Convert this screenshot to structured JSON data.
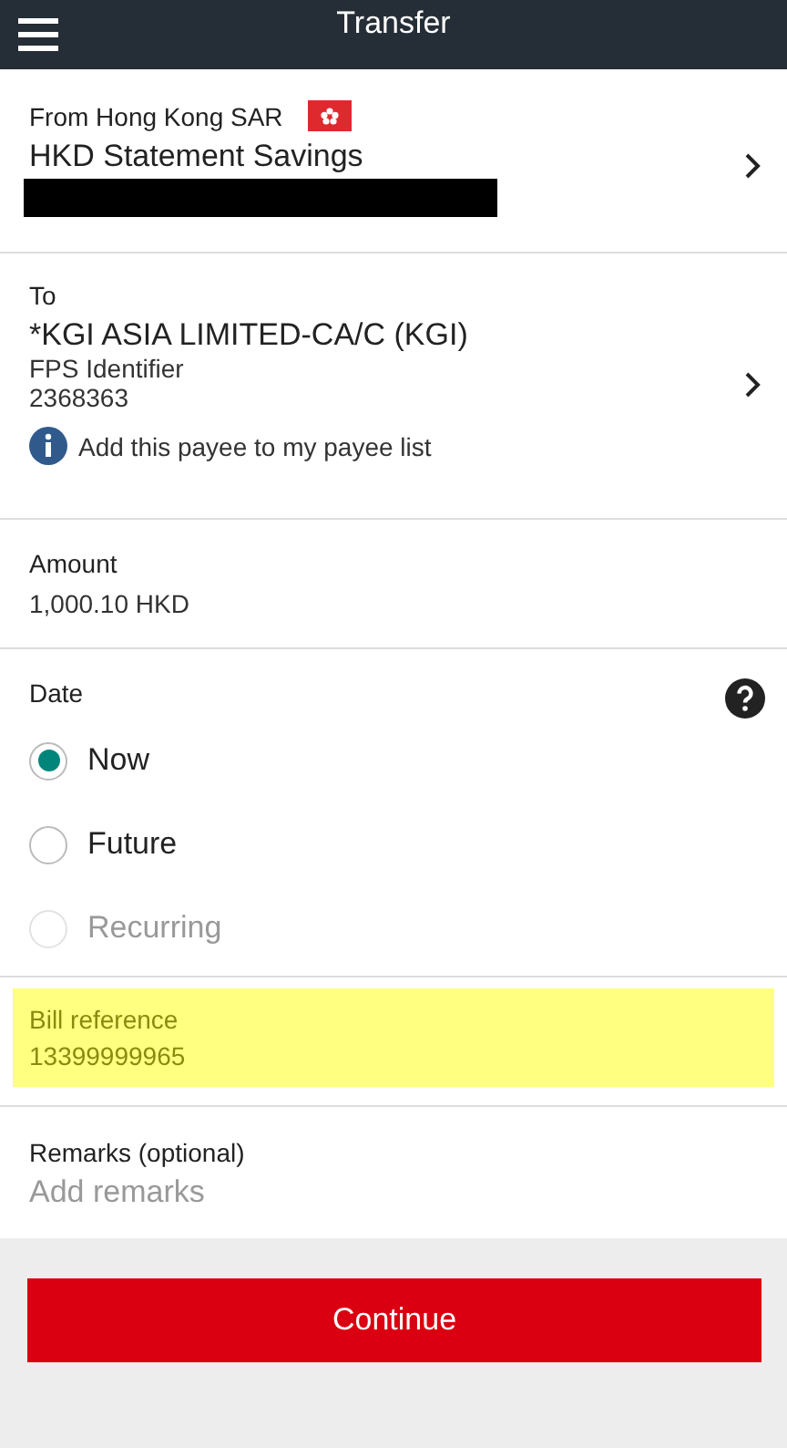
{
  "header": {
    "title": "Transfer"
  },
  "from": {
    "label": "From Hong Kong SAR",
    "account": "HKD Statement Savings",
    "account_number_redacted": true
  },
  "to": {
    "label": "To",
    "payee": "*KGI ASIA LIMITED-CA/C (KGI)",
    "id_type": "FPS Identifier",
    "id_value": "2368363",
    "add_payee_link": "Add this payee to my payee list"
  },
  "amount": {
    "label": "Amount",
    "value": "1,000.10 HKD"
  },
  "date": {
    "label": "Date",
    "options": [
      {
        "label": "Now",
        "selected": true,
        "disabled": false
      },
      {
        "label": "Future",
        "selected": false,
        "disabled": false
      },
      {
        "label": "Recurring",
        "selected": false,
        "disabled": true
      }
    ]
  },
  "bill_reference": {
    "label": "Bill reference",
    "value": "13399999965",
    "highlighted": true
  },
  "remarks": {
    "label": "Remarks (optional)",
    "placeholder": "Add remarks"
  },
  "continue_button": {
    "label": "Continue"
  }
}
